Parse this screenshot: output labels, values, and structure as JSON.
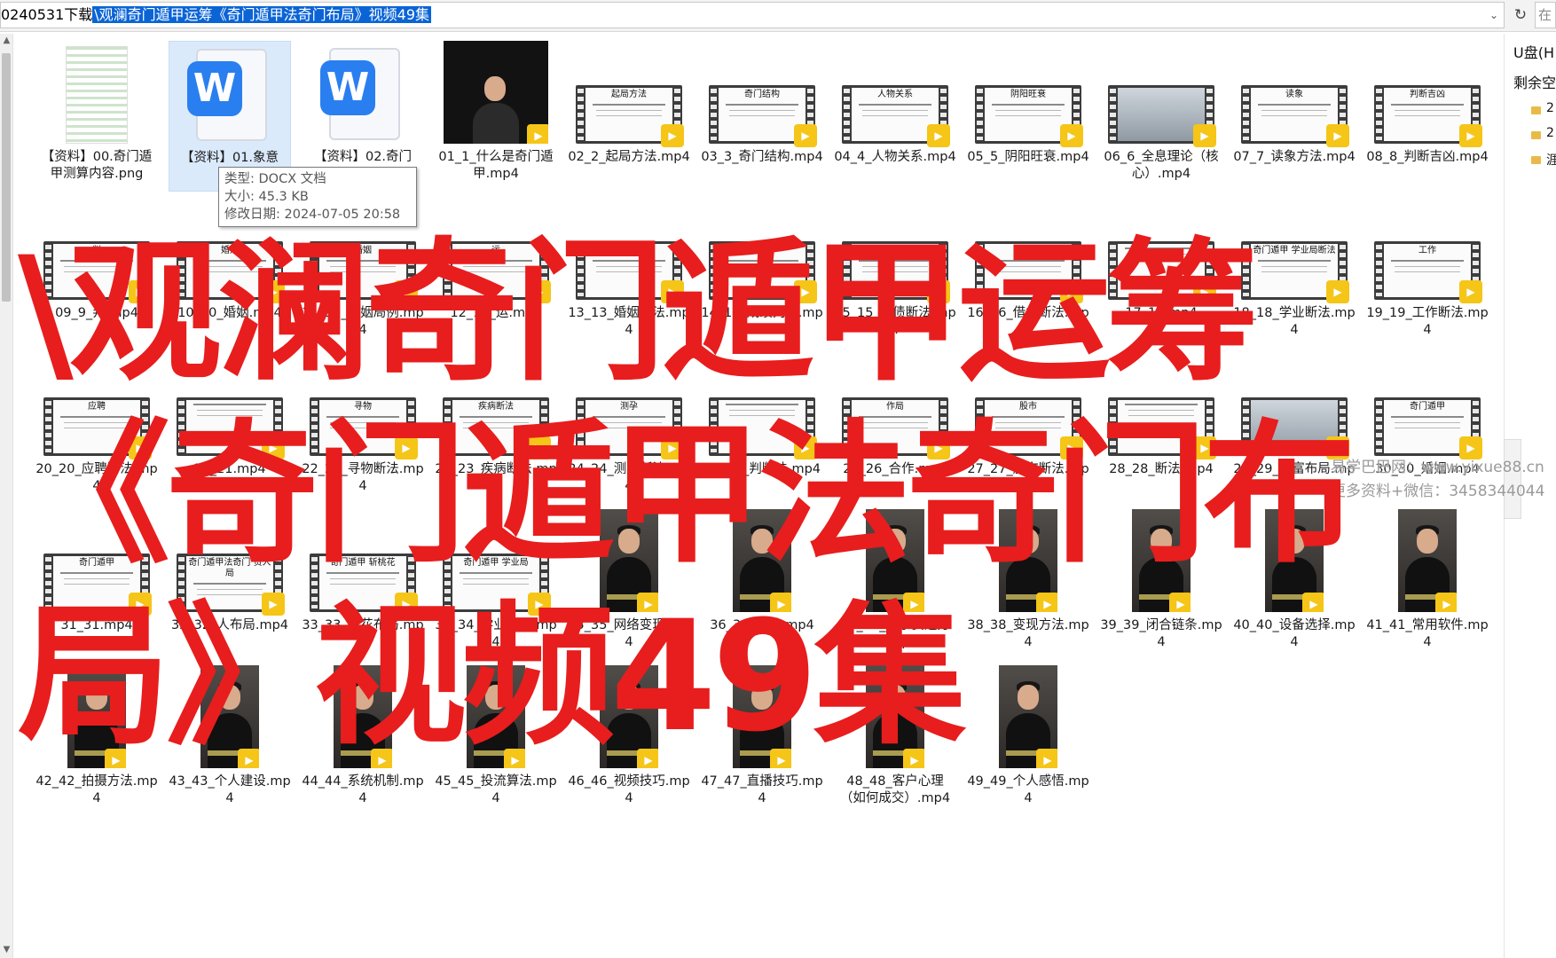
{
  "address": {
    "prefix": "0240531下载",
    "selected": "\\观澜奇门遁甲运筹《奇门遁甲法奇门布局》视频49集",
    "search_fragment": "在"
  },
  "tooltip": {
    "type": "类型: DOCX 文档",
    "size": "大小: 45.3 KB",
    "modified": "修改日期: 2024-07-05 20:58"
  },
  "nav": {
    "drive": "U盘(H",
    "free": "剩余空",
    "rows": [
      "2",
      "2",
      "涯"
    ]
  },
  "overlay": {
    "title": "\\观澜奇门遁甲运筹《奇门遁甲法奇门布局》视频49集"
  },
  "watermark": {
    "line1": "易学巴巴网：www.yixue88.cn",
    "line2": "更多资料+微信：3458344044"
  },
  "files": [
    {
      "name": "【资料】00.奇门遁甲测算内容.png",
      "kind": "png"
    },
    {
      "name": "【资料】01.象意",
      "kind": "doc"
    },
    {
      "name": "【资料】02.奇门",
      "kind": "doc"
    },
    {
      "name": "01_1_什么是奇门遁甲.mp4",
      "kind": "video-photo"
    },
    {
      "name": "02_2_起局方法.mp4",
      "kind": "video-doc",
      "cap": "起局方法"
    },
    {
      "name": "03_3_奇门结构.mp4",
      "kind": "video-doc",
      "cap": "奇门结构"
    },
    {
      "name": "04_4_人物关系.mp4",
      "kind": "video-doc",
      "cap": "人物关系"
    },
    {
      "name": "05_5_阴阳旺衰.mp4",
      "kind": "video-doc",
      "cap": "阴阳旺衰"
    },
    {
      "name": "06_6_全息理论（核心）.mp4",
      "kind": "video-person"
    },
    {
      "name": "07_7_读象方法.mp4",
      "kind": "video-doc",
      "cap": "读象"
    },
    {
      "name": "08_8_判断吉凶.mp4",
      "kind": "video-doc",
      "cap": "判断吉凶"
    },
    {
      "name": "09_9_判.mp4",
      "kind": "video-doc",
      "cap": "判"
    },
    {
      "name": "10_10_婚姻.mp4",
      "kind": "video-doc",
      "cap": "婚姻"
    },
    {
      "name": "11_11_婚姻局例.mp4",
      "kind": "video-doc",
      "cap": "婚姻"
    },
    {
      "name": "12_12_运.mp4",
      "kind": "video-doc",
      "cap": "运"
    },
    {
      "name": "13_13_婚姻方法.mp4",
      "kind": "video-doc",
      "cap": "婚姻方法"
    },
    {
      "name": "14_14_成绩判断.mp4",
      "kind": "video-doc",
      "cap": "成绩"
    },
    {
      "name": "15_15_讨债断法.mp4",
      "kind": "video-doc",
      "cap": "讨债"
    },
    {
      "name": "16_16_借贷断法.mp4",
      "kind": "video-doc",
      "cap": "借贷"
    },
    {
      "name": "17_17.mp4",
      "kind": "video-doc",
      "cap": ""
    },
    {
      "name": "18_18_学业断法.mp4",
      "kind": "video-doc",
      "cap": "奇门遁甲 学业局断法"
    },
    {
      "name": "19_19_工作断法.mp4",
      "kind": "video-doc",
      "cap": "工作"
    },
    {
      "name": "20_20_应聘断法.mp4",
      "kind": "video-doc",
      "cap": "应聘"
    },
    {
      "name": "21_21.mp4",
      "kind": "video-doc",
      "cap": ""
    },
    {
      "name": "22_22_寻物断法.mp4",
      "kind": "video-doc",
      "cap": "寻物"
    },
    {
      "name": "23_23_疾病断法.mp4",
      "kind": "video-doc",
      "cap": "疾病断法"
    },
    {
      "name": "24_24_测孕断法.mp4",
      "kind": "video-doc",
      "cap": "测孕"
    },
    {
      "name": "25_25_判断法.mp4",
      "kind": "video-doc",
      "cap": ""
    },
    {
      "name": "26_26_合作.mp4",
      "kind": "video-doc",
      "cap": "作局"
    },
    {
      "name": "27_27_股市断法.mp4",
      "kind": "video-doc",
      "cap": "股市"
    },
    {
      "name": "28_28_断法.mp4",
      "kind": "video-doc",
      "cap": ""
    },
    {
      "name": "29_29_财富布局.mp4",
      "kind": "video-photo2"
    },
    {
      "name": "30_30_婚姻.mp4",
      "kind": "video-doc",
      "cap": "奇门遁甲"
    },
    {
      "name": "31_31.mp4",
      "kind": "video-doc",
      "cap": "奇门遁甲"
    },
    {
      "name": "32_32_人布局.mp4",
      "kind": "video-doc",
      "cap": "奇门遁甲法奇门 贵人局"
    },
    {
      "name": "33_33_桃花布局.mp4",
      "kind": "video-doc",
      "cap": "奇门遁甲 斩桃花"
    },
    {
      "name": "34_34_学业布局.mp4",
      "kind": "video-doc",
      "cap": "奇门遁甲 学业局"
    },
    {
      "name": "35_35_网络变现.mp4",
      "kind": "video-portrait"
    },
    {
      "name": "36_36_吐纳.mp4",
      "kind": "video-portrait"
    },
    {
      "name": "37_37_国学赛道方向.mp4",
      "kind": "video-portrait"
    },
    {
      "name": "38_38_变现方法.mp4",
      "kind": "video-portrait"
    },
    {
      "name": "39_39_闭合链条.mp4",
      "kind": "video-portrait"
    },
    {
      "name": "40_40_设备选择.mp4",
      "kind": "video-portrait"
    },
    {
      "name": "41_41_常用软件.mp4",
      "kind": "video-portrait"
    },
    {
      "name": "42_42_拍摄方法.mp4",
      "kind": "video-portrait"
    },
    {
      "name": "43_43_个人建设.mp4",
      "kind": "video-portrait"
    },
    {
      "name": "44_44_系统机制.mp4",
      "kind": "video-portrait"
    },
    {
      "name": "45_45_投流算法.mp4",
      "kind": "video-portrait"
    },
    {
      "name": "46_46_视频技巧.mp4",
      "kind": "video-portrait"
    },
    {
      "name": "47_47_直播技巧.mp4",
      "kind": "video-portrait"
    },
    {
      "name": "48_48_客户心理（如何成交）.mp4",
      "kind": "video-portrait"
    },
    {
      "name": "49_49_个人感悟.mp4",
      "kind": "video-portrait"
    }
  ],
  "colors": {
    "overlay_red": "#e81d1d",
    "selection_blue": "#0a64d6",
    "player_badge": "#f5c518",
    "word_icon": "#2a7ff0"
  }
}
